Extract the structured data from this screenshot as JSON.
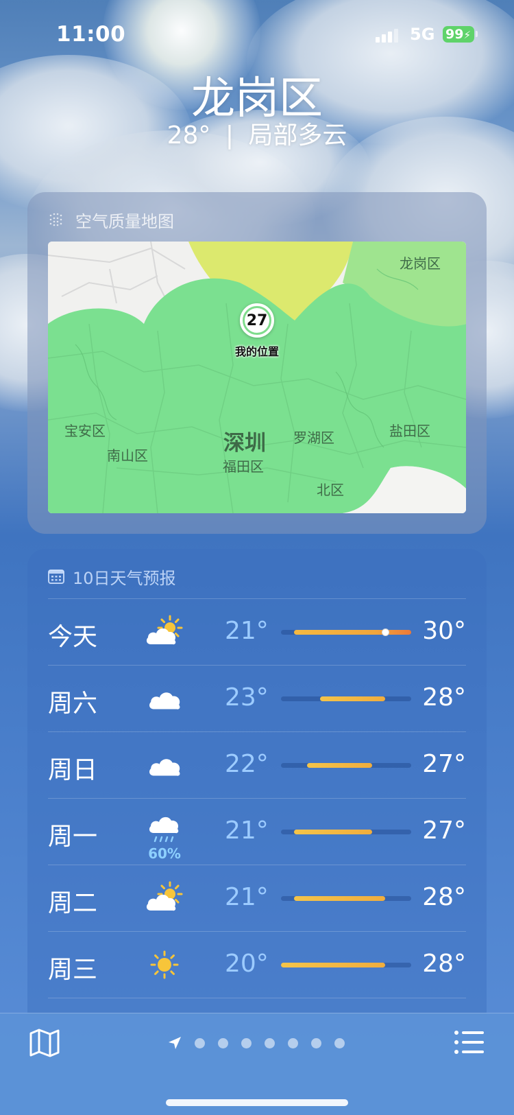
{
  "status_bar": {
    "time": "11:00",
    "network": "5G",
    "battery": "99"
  },
  "header": {
    "location": "龙岗区",
    "current_temp": "28°",
    "condition": "局部多云",
    "summary": "28° | 局部多云"
  },
  "air_quality": {
    "title": "空气质量地图",
    "aqi_value": "27",
    "pin_label": "我的位置",
    "map_labels": {
      "longgang": "龙岗区",
      "baoan": "宝安区",
      "nanshan": "南山区",
      "shenzhen": "深圳",
      "futian": "福田区",
      "luohu": "罗湖区",
      "yantian": "盐田区",
      "north": "北区"
    },
    "colors": {
      "good": "#7de08f",
      "moderate": "#dde86d",
      "light_green": "#9fe68f"
    }
  },
  "forecast": {
    "title": "10日天气预报",
    "range_min": 20,
    "range_max": 30,
    "current_temp_value": 28,
    "days": [
      {
        "day": "今天",
        "icon": "partly-cloudy-day-icon",
        "low": "21°",
        "high": "30°",
        "low_v": 21,
        "high_v": 30,
        "precip": ""
      },
      {
        "day": "周六",
        "icon": "cloud-icon",
        "low": "23°",
        "high": "28°",
        "low_v": 23,
        "high_v": 28,
        "precip": ""
      },
      {
        "day": "周日",
        "icon": "cloud-icon",
        "low": "22°",
        "high": "27°",
        "low_v": 22,
        "high_v": 27,
        "precip": ""
      },
      {
        "day": "周一",
        "icon": "cloud-drizzle-icon",
        "low": "21°",
        "high": "27°",
        "low_v": 21,
        "high_v": 27,
        "precip": "60%"
      },
      {
        "day": "周二",
        "icon": "partly-cloudy-day-icon",
        "low": "21°",
        "high": "28°",
        "low_v": 21,
        "high_v": 28,
        "precip": ""
      },
      {
        "day": "周三",
        "icon": "sun-icon",
        "low": "20°",
        "high": "28°",
        "low_v": 20,
        "high_v": 28,
        "precip": ""
      }
    ]
  },
  "toolbar": {
    "page_count": 7
  }
}
